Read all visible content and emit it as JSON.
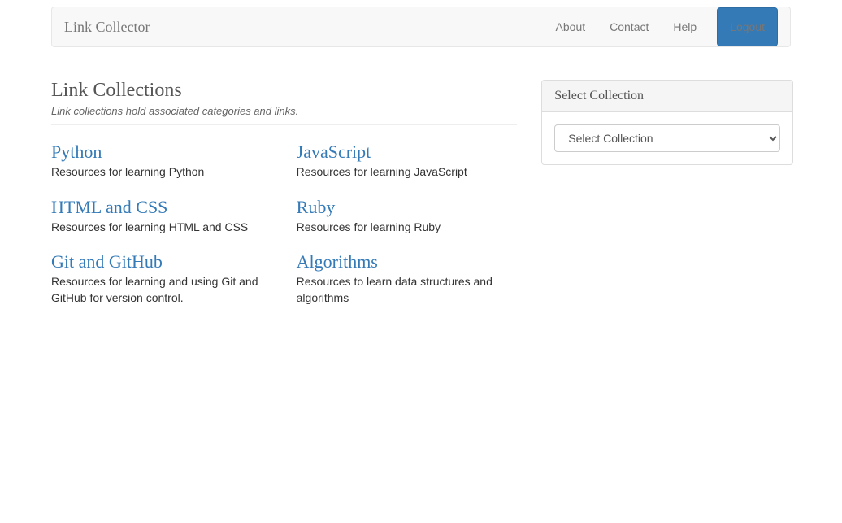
{
  "navbar": {
    "brand": "Link Collector",
    "links": {
      "about": "About",
      "contact": "Contact",
      "help": "Help"
    },
    "logout": "Logout"
  },
  "header": {
    "title": "Link Collections",
    "subtitle": "Link collections hold associated categories and links."
  },
  "collections": [
    {
      "title": "Python",
      "description": "Resources for learning Python"
    },
    {
      "title": "JavaScript",
      "description": "Resources for learning JavaScript"
    },
    {
      "title": "HTML and CSS",
      "description": "Resources for learning HTML and CSS"
    },
    {
      "title": "Ruby",
      "description": "Resources for learning Ruby"
    },
    {
      "title": "Git and GitHub",
      "description": "Resources for learning and using Git and GitHub for version control."
    },
    {
      "title": "Algorithms",
      "description": "Resources to learn data structures and algorithms"
    }
  ],
  "sidebar": {
    "panel_title": "Select Collection",
    "select_placeholder": "Select Collection"
  }
}
